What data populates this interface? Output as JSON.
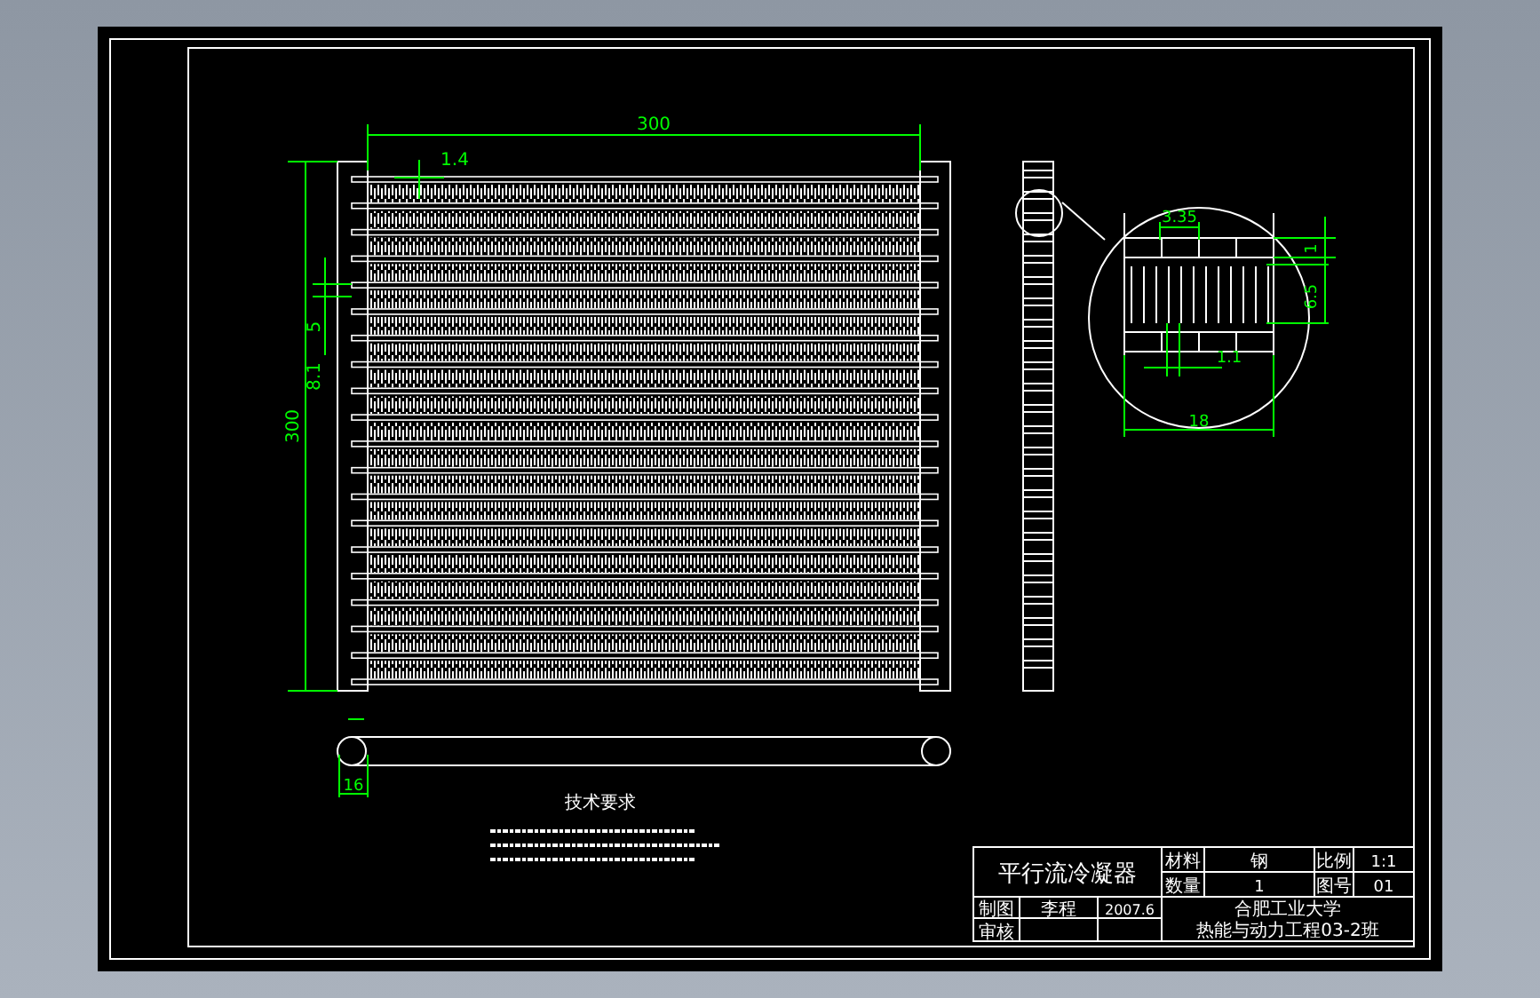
{
  "front_view": {
    "width_dim": "300",
    "fin_dim": "1.4",
    "height_dim": "300",
    "pitch_dim": "8.1",
    "tube_dim": "5"
  },
  "detail_view": {
    "dims": [
      "3.35",
      "1.1",
      "18",
      "6.5",
      "1"
    ]
  },
  "header_view": {
    "dim": "16"
  },
  "notes": {
    "title": "技术要求"
  },
  "title_block": {
    "name": "平行流冷凝器",
    "material_label": "材料",
    "material": "钢",
    "scale_label": "比例",
    "scale": "1:1",
    "count_label": "数量",
    "count": "1",
    "number_label": "图号",
    "number": "01",
    "drawn_label": "制图",
    "drawn_by": "李程",
    "date": "2007.6",
    "check_label": "审核",
    "school": "合肥工业大学",
    "class": "热能与动力工程03-2班"
  }
}
